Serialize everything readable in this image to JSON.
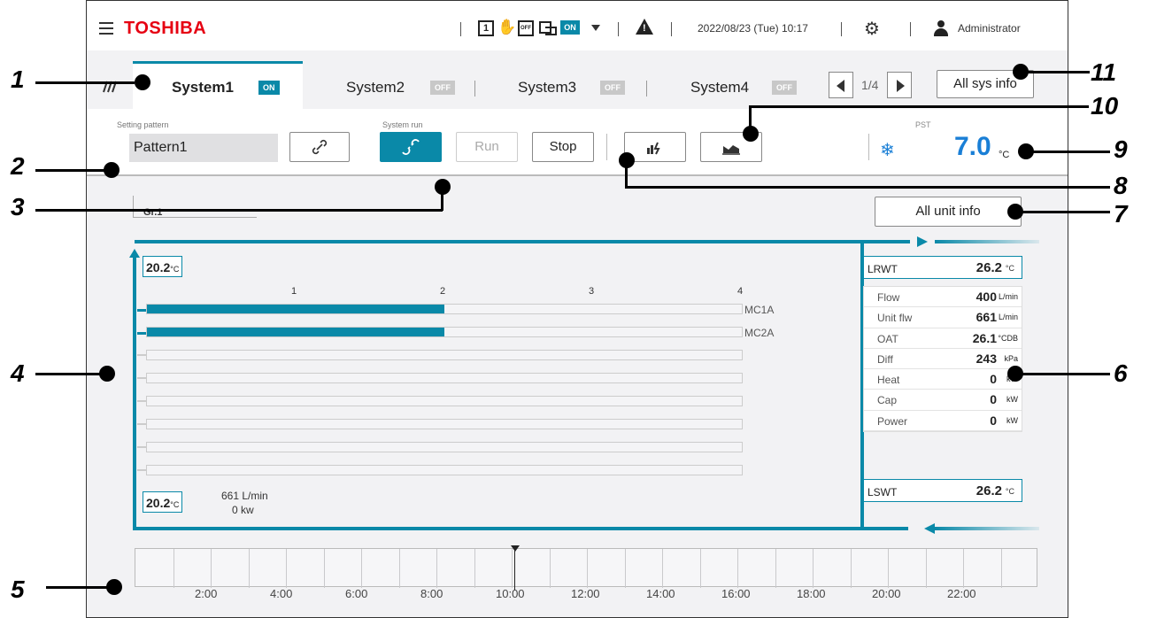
{
  "topbar": {
    "logo": "TOSHIBA",
    "mode_1": "1",
    "mode_off": "OFF",
    "on_badge": "ON",
    "datetime": "2022/08/23 (Tue) 10:17",
    "user": "Administrator",
    "icons": [
      "menu-icon",
      "mode-1-icon",
      "manual-hand-icon",
      "calendar-off-icon",
      "schedule-switch-icon",
      "caret-down-icon",
      "warning-icon",
      "gear-icon",
      "user-icon"
    ]
  },
  "tabs": {
    "items": [
      {
        "label": "System1",
        "status": "ON"
      },
      {
        "label": "System2",
        "status": "OFF"
      },
      {
        "label": "System3",
        "status": "OFF"
      },
      {
        "label": "System4",
        "status": "OFF"
      }
    ],
    "page": "1/4",
    "all_sys_info": "All sys info"
  },
  "control": {
    "setting_pattern_label": "Setting pattern",
    "pattern_value": "Pattern1",
    "system_run_label": "System run",
    "run": "Run",
    "stop": "Stop",
    "pst_label": "PST",
    "pst_value": "7.0",
    "pst_unit": "°C"
  },
  "main": {
    "group": "Gr.1",
    "all_unit_info": "All unit info",
    "top_temp": "20.2",
    "bottom_temp": "20.2",
    "temp_unit": "°C",
    "axis": [
      "1",
      "2",
      "3",
      "4"
    ],
    "units": [
      {
        "name": "MC1A",
        "level": 2
      },
      {
        "name": "MC2A",
        "level": 2
      }
    ],
    "empty_rows": 6,
    "flow_text": "661 L/min",
    "power_text": "0 kw"
  },
  "right_panel": {
    "lrwt": {
      "label": "LRWT",
      "value": "26.2",
      "unit": "°C"
    },
    "lswt": {
      "label": "LSWT",
      "value": "26.2",
      "unit": "°C"
    },
    "rows": [
      {
        "label": "Flow",
        "value": "400",
        "unit": "L/min"
      },
      {
        "label": "Unit flw",
        "value": "661",
        "unit": "L/min"
      },
      {
        "label": "OAT",
        "value": "26.1",
        "unit": "°CDB"
      },
      {
        "label": "Diff",
        "value": "243",
        "unit": "kPa"
      },
      {
        "label": "Heat",
        "value": "0",
        "unit": "kW"
      },
      {
        "label": "Cap",
        "value": "0",
        "unit": "kW"
      },
      {
        "label": "Power",
        "value": "0",
        "unit": "kW"
      }
    ]
  },
  "timeline": {
    "labels": [
      "2:00",
      "4:00",
      "6:00",
      "8:00",
      "10:00",
      "12:00",
      "14:00",
      "16:00",
      "18:00",
      "20:00",
      "22:00"
    ],
    "current": "10:17"
  },
  "callouts": [
    "1",
    "2",
    "3",
    "4",
    "5",
    "6",
    "7",
    "8",
    "9",
    "10",
    "11"
  ],
  "colors": {
    "accent": "#0a89a8",
    "brand": "#e60012",
    "pst": "#1a7fd6",
    "off": "#c8c8c8"
  }
}
